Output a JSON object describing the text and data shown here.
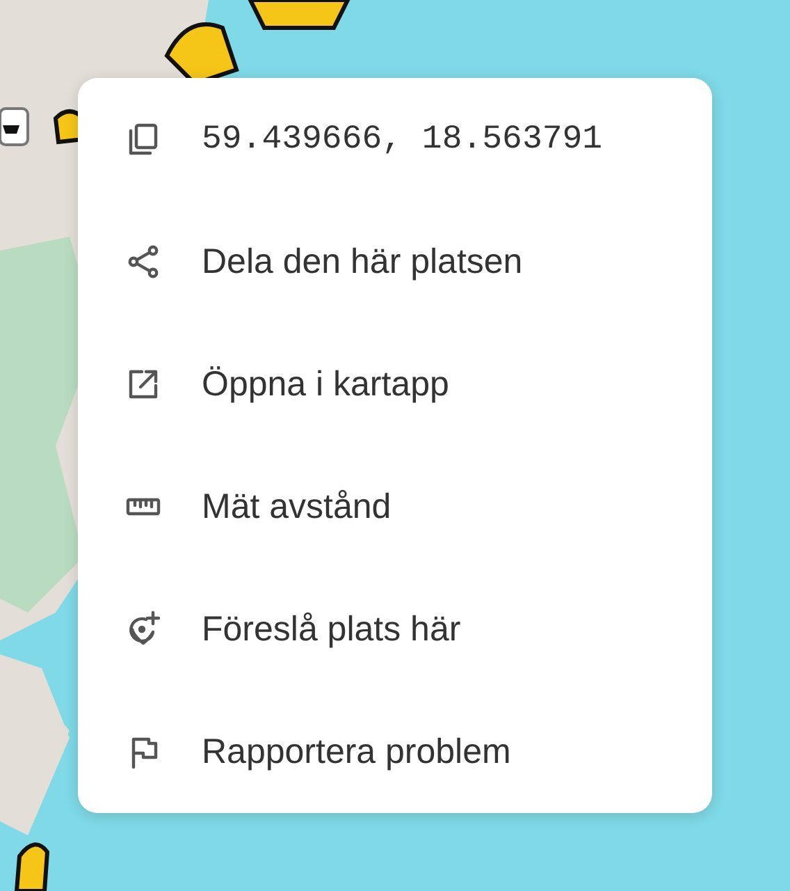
{
  "context_menu": {
    "items": [
      {
        "kind": "coordinates",
        "label": "59.439666, 18.563791"
      },
      {
        "kind": "share",
        "label": "Dela den här platsen"
      },
      {
        "kind": "open-external",
        "label": "Öppna i kartapp"
      },
      {
        "kind": "measure",
        "label": "Mät avstånd"
      },
      {
        "kind": "suggest-place",
        "label": "Föreslå plats här"
      },
      {
        "kind": "report",
        "label": "Rapportera problem"
      }
    ]
  }
}
